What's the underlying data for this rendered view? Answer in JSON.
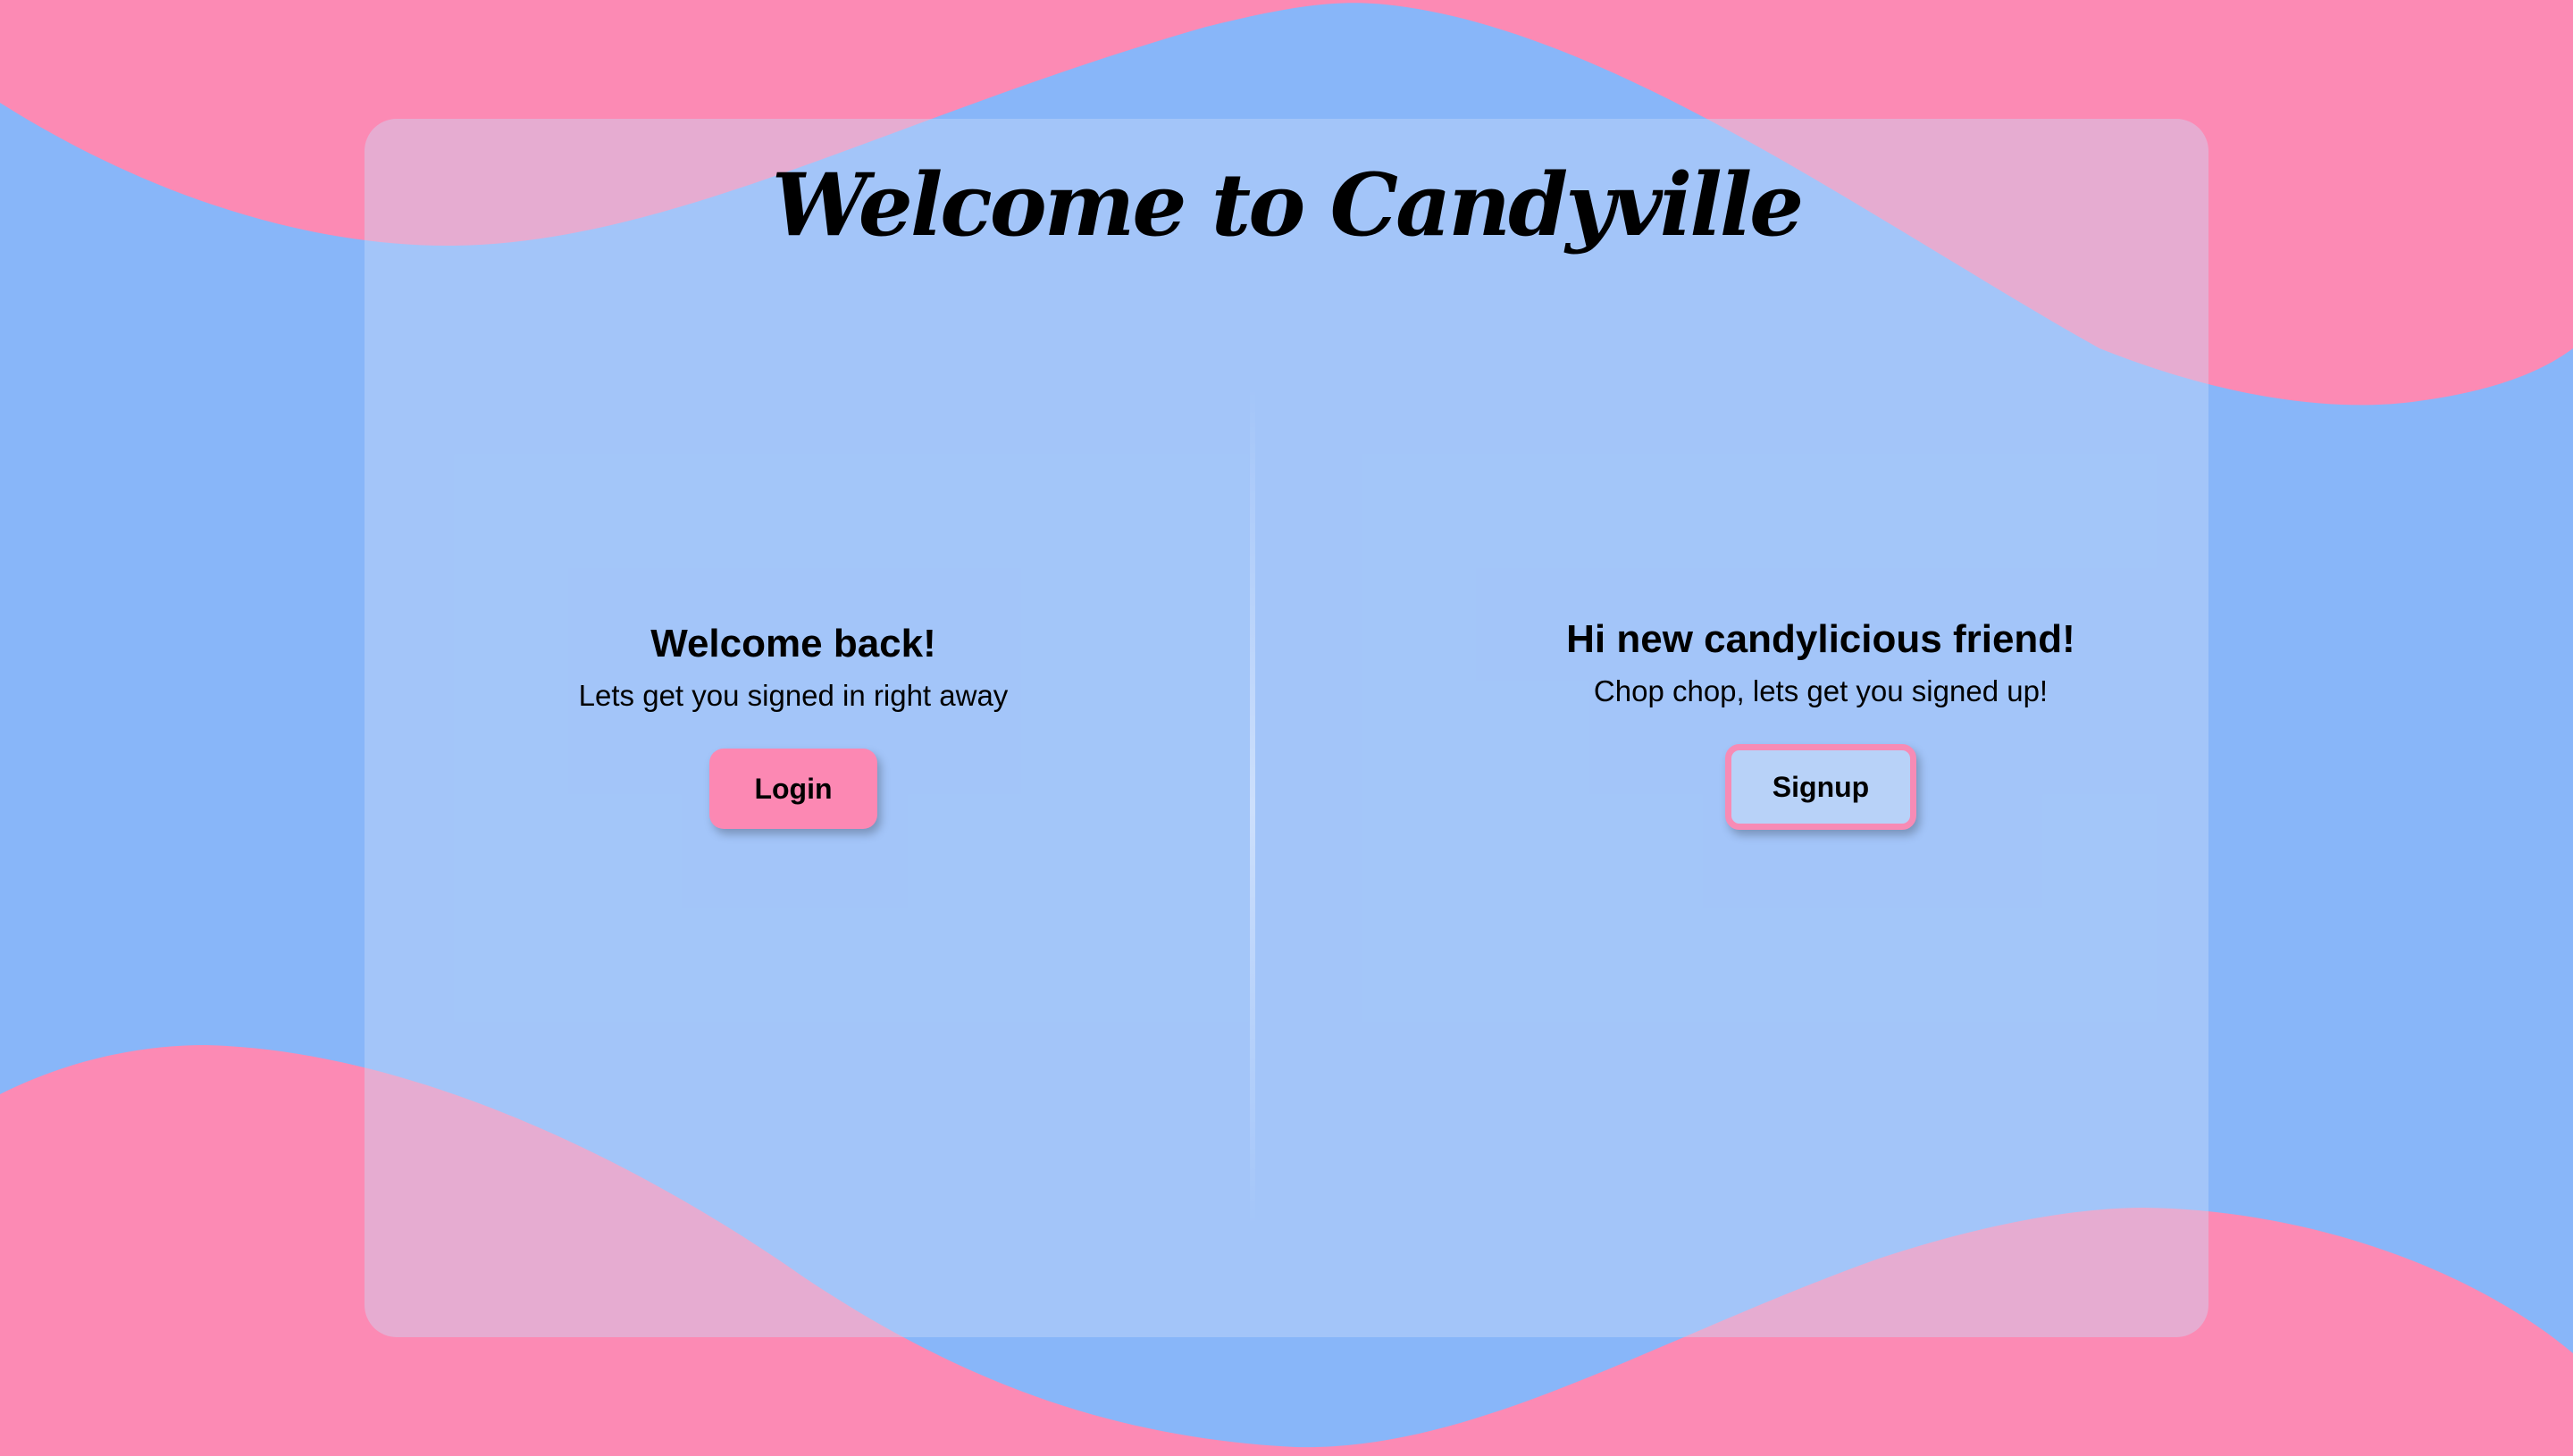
{
  "theme": {
    "background": "#88b6f9",
    "wave_color": "#fc8ab4",
    "accent_pink": "#fc88b3",
    "signup_fill": "#b8d2f8"
  },
  "title": "Welcome to Candyville",
  "login_panel": {
    "heading": "Welcome back!",
    "subtext": "Lets get you signed in right away",
    "button_label": "Login"
  },
  "signup_panel": {
    "heading": "Hi new candylicious friend!",
    "subtext": "Chop chop, lets get you signed up!",
    "button_label": "Signup"
  }
}
